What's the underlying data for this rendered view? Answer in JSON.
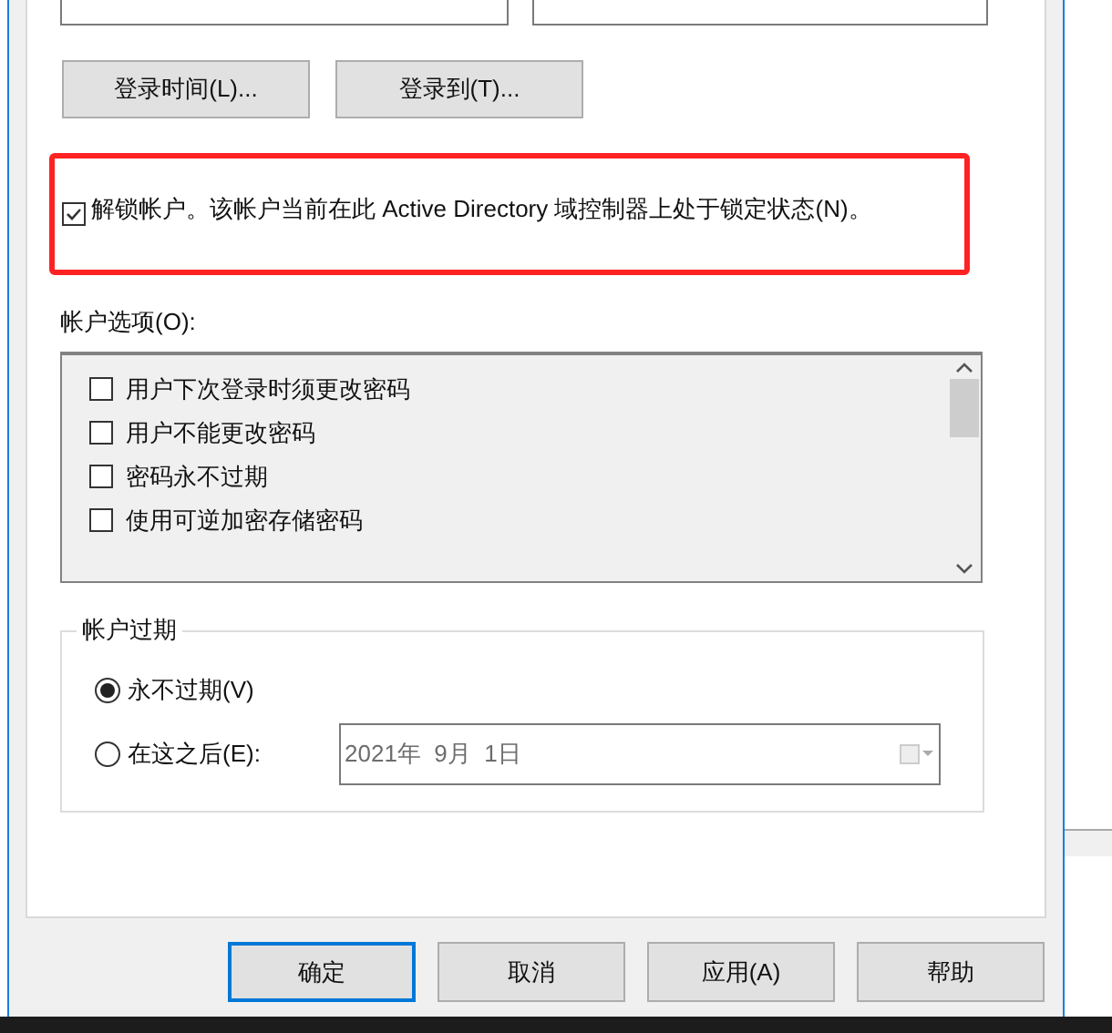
{
  "top_buttons": [
    "登录时间(L)...",
    "登录到(T)..."
  ],
  "unlock": {
    "label": "解锁帐户。该帐户当前在此 Active Directory 域控制器上处于锁定状态(N)。",
    "checked": true
  },
  "account_options": {
    "label": "帐户选项(O):",
    "items": [
      {
        "label": "用户下次登录时须更改密码",
        "checked": false
      },
      {
        "label": "用户不能更改密码",
        "checked": false
      },
      {
        "label": "密码永不过期",
        "checked": false
      },
      {
        "label": "使用可逆加密存储密码",
        "checked": false
      }
    ]
  },
  "account_expires": {
    "title": "帐户过期",
    "options": [
      {
        "label": "永不过期(V)",
        "selected": true
      },
      {
        "label": "在这之后(E):",
        "selected": false
      }
    ],
    "date": "2021年  9月  1日"
  },
  "dialog_buttons": [
    {
      "label": "确定",
      "default": true
    },
    {
      "label": "取消",
      "default": false
    },
    {
      "label": "应用(A)",
      "default": false
    },
    {
      "label": "帮助",
      "default": false
    }
  ]
}
